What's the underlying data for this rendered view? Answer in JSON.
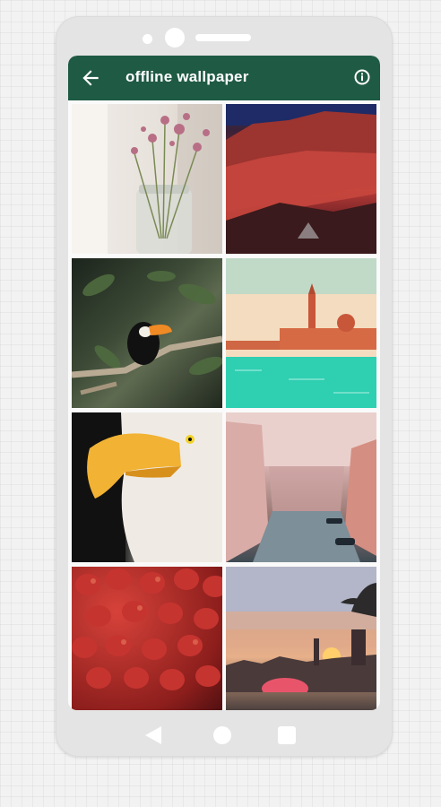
{
  "appbar": {
    "title": "offline wallpaper",
    "back_icon": "arrow-left-icon",
    "info_icon": "info-circle-icon",
    "color": "#1f5a44"
  },
  "wallpapers": [
    {
      "subject": "dried flowers in glass jar"
    },
    {
      "subject": "red canyon cliffs at dusk"
    },
    {
      "subject": "toucan on branch"
    },
    {
      "subject": "illustrated venice waterfront"
    },
    {
      "subject": "bald eagle closeup"
    },
    {
      "subject": "venice canal street"
    },
    {
      "subject": "strawberries"
    },
    {
      "subject": "sunset city skyline"
    }
  ],
  "system_nav": {
    "back_icon": "triangle-back-icon",
    "home_icon": "circle-home-icon",
    "recents_icon": "square-recents-icon"
  }
}
